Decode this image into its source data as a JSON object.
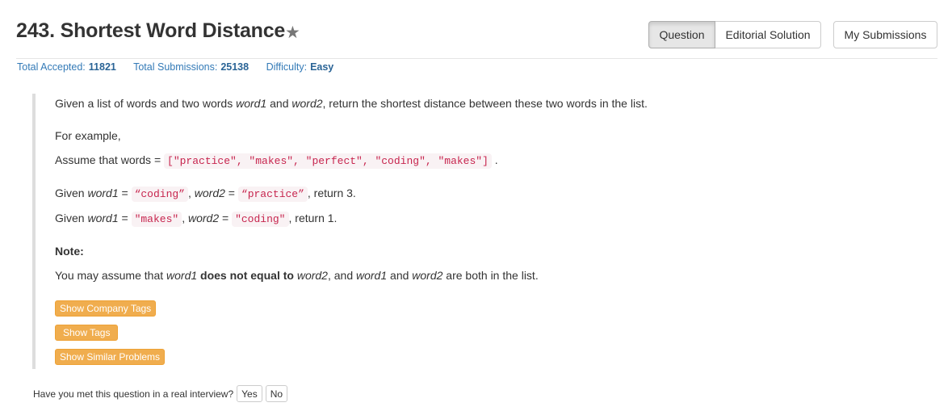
{
  "problem": {
    "title": "243. Shortest Word Distance",
    "star_icon": "star-icon"
  },
  "tabs": {
    "question": "Question",
    "editorial": "Editorial Solution",
    "my_submissions": "My Submissions"
  },
  "stats": {
    "accepted_label": "Total Accepted:",
    "accepted_value": "11821",
    "submissions_label": "Total Submissions:",
    "submissions_value": "25138",
    "difficulty_label": "Difficulty:",
    "difficulty_value": "Easy"
  },
  "content": {
    "intro_a": "Given a list of words and two words ",
    "intro_word1": "word1",
    "intro_b": " and ",
    "intro_word2": "word2",
    "intro_c": ", return the shortest distance between these two words in the list.",
    "example_label": "For example,",
    "assume_prefix": "Assume that words = ",
    "words_code": "[\"practice\", \"makes\", \"perfect\", \"coding\", \"makes\"]",
    "assume_suffix": ".",
    "ex1_given": "Given ",
    "ex1_w1": "word1",
    "ex1_eq1": " = ",
    "ex1_code1": "“coding”",
    "ex1_comma": ", ",
    "ex1_w2": "word2",
    "ex1_eq2": " = ",
    "ex1_code2": "“practice”",
    "ex1_ret": ", return 3.",
    "ex2_given": "Given ",
    "ex2_w1": "word1",
    "ex2_eq1": " = ",
    "ex2_code1": "\"makes\"",
    "ex2_comma": ", ",
    "ex2_w2": "word2",
    "ex2_eq2": " = ",
    "ex2_code2": "\"coding\"",
    "ex2_ret": ", return 1.",
    "note_label": "Note:",
    "note_a": "You may assume that ",
    "note_w1": "word1",
    "note_b": " does not equal to ",
    "note_w2": "word2",
    "note_c": ", and ",
    "note_w1b": "word1",
    "note_d": " and ",
    "note_w2b": "word2",
    "note_e": " are both in the list."
  },
  "buttons": {
    "company_tags": "Show Company Tags",
    "tags": "Show Tags",
    "similar": "Show Similar Problems"
  },
  "interview": {
    "question": "Have you met this question in a real interview?",
    "yes": "Yes",
    "no": "No"
  }
}
